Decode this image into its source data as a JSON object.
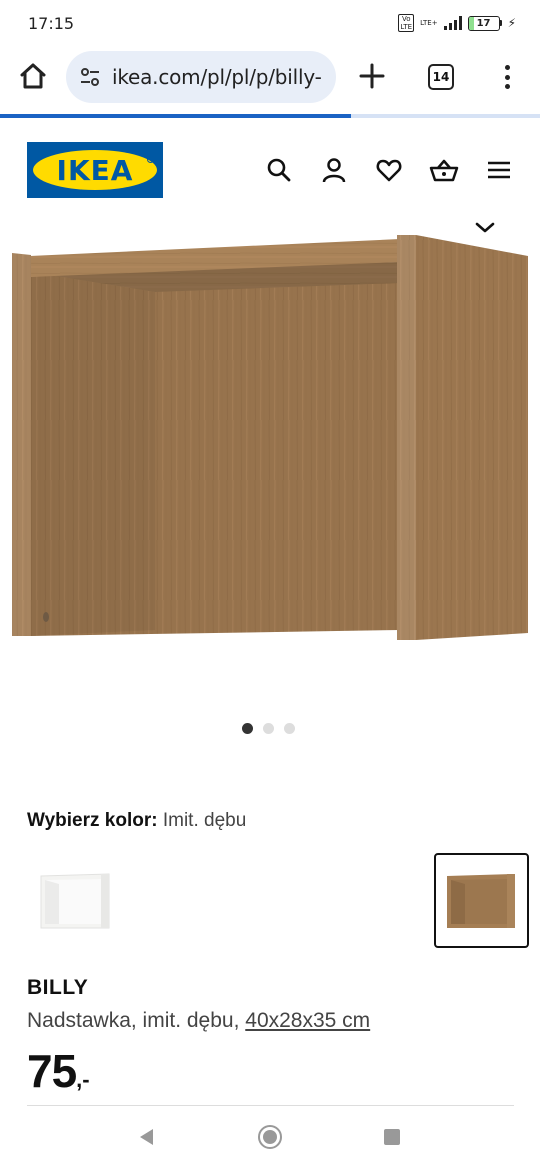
{
  "status_bar": {
    "time": "17:15",
    "volte": "Vo LTE",
    "network": "LTE+",
    "battery": "17",
    "battery_level": 0.17,
    "charging_icon": "bolt-icon"
  },
  "browser": {
    "url": "ikea.com/pl/pl/p/billy-",
    "tab_count": "14",
    "load_progress": 0.65,
    "icons": [
      "home-icon",
      "site-settings-icon",
      "plus-icon",
      "tabs-icon",
      "more-vert-icon"
    ],
    "accent": "#1a63c4",
    "pill_color": "#e8eef8"
  },
  "header": {
    "logo_text": "IKEA",
    "logo_colors": {
      "blue": "#0058a3",
      "yellow": "#ffdb00"
    },
    "icons": [
      "search-icon",
      "user-icon",
      "heart-icon",
      "basket-icon",
      "hamburger-menu-icon"
    ]
  },
  "gallery": {
    "slide_count": 3,
    "active_slide": 1,
    "collapse_icon": "chevron-down-icon"
  },
  "product": {
    "color_label": "Wybierz kolor:",
    "color_value": "Imit. dębu",
    "swatches": [
      {
        "color": "white",
        "selected": false
      },
      {
        "color": "oak",
        "selected": true
      }
    ],
    "name": "BILLY",
    "description": "Nadstawka, imit. dębu, ",
    "dimensions": "40x28x35 cm",
    "price": "75",
    "price_suffix": ",-"
  },
  "nav_bar": {
    "icons": [
      "back-icon",
      "home-circle-icon",
      "recents-icon"
    ]
  }
}
